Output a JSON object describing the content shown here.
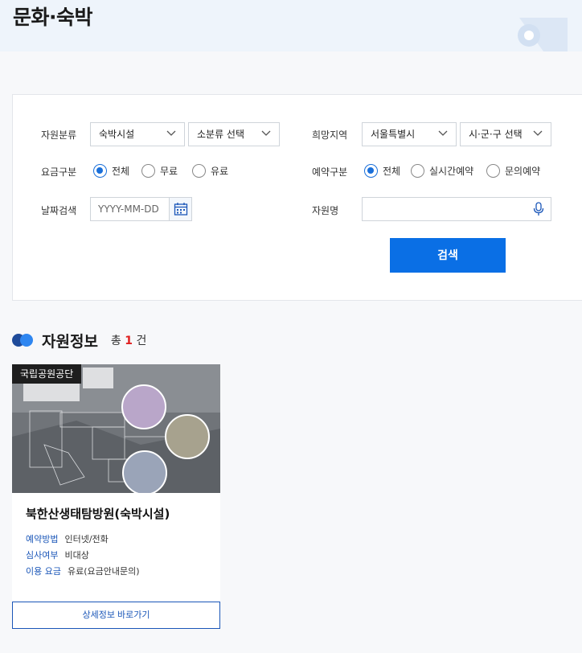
{
  "header": {
    "title": "문화·숙박"
  },
  "search": {
    "resource_category": {
      "label": "자원분류",
      "main_value": "숙박시설",
      "sub_value": "소분류 선택"
    },
    "region": {
      "label": "희망지역",
      "city_value": "서울특별시",
      "district_value": "시·군·구 선택"
    },
    "fee": {
      "label": "요금구분",
      "options": [
        "전체",
        "무료",
        "유료"
      ],
      "selected": "전체"
    },
    "reservation": {
      "label": "예약구분",
      "options": [
        "전체",
        "실시간예약",
        "문의예약"
      ],
      "selected": "전체"
    },
    "date": {
      "label": "날짜검색",
      "placeholder": "YYYY-MM-DD"
    },
    "name": {
      "label": "자원명",
      "placeholder": ""
    },
    "submit_label": "검색"
  },
  "results": {
    "section_title": "자원정보",
    "count_prefix": "총",
    "count": "1",
    "count_suffix": "건"
  },
  "card": {
    "badge": "국립공원공단",
    "title": "북한산생태탐방원(숙박시설)",
    "rows": [
      {
        "key": "예약방법",
        "value": "인터넷/전화"
      },
      {
        "key": "심사여부",
        "value": "비대상"
      },
      {
        "key": "이용 요금",
        "value": "유료(요금안내문의)"
      }
    ],
    "detail_label": "상세정보 바로가기"
  },
  "colors": {
    "primary": "#0a6fe5",
    "accent_dark": "#1a56b8",
    "count_red": "#e02020"
  }
}
